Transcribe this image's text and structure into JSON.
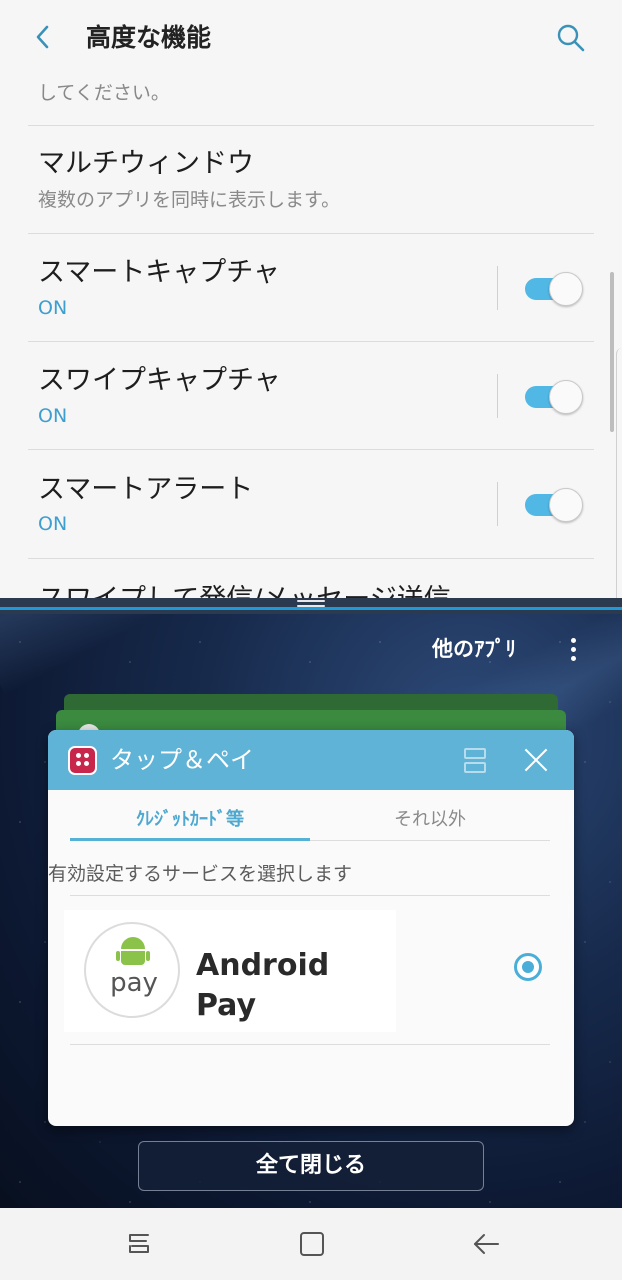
{
  "header": {
    "title": "高度な機能",
    "back_icon": "arrow-left-icon",
    "search_icon": "search-icon"
  },
  "settings": {
    "partial_text": "してください。",
    "multi_window": {
      "title": "マルチウィンドウ",
      "subtitle": "複数のアプリを同時に表示します。"
    },
    "smart_capture": {
      "title": "スマートキャプチャ",
      "status": "ON",
      "enabled": true
    },
    "swipe_capture": {
      "title": "スワイプキャプチャ",
      "status": "ON",
      "enabled": true
    },
    "smart_alert": {
      "title": "スマートアラート",
      "status": "ON",
      "enabled": true
    },
    "cut_item": {
      "title": "スワイプして発信/メッセージ送信"
    }
  },
  "recents": {
    "other_apps": "他のｱﾌﾟﾘ",
    "close_all": "全て閉じる",
    "card": {
      "title": "タップ＆ペイ",
      "tabs": [
        "ｸﾚｼﾞｯﾄｶｰﾄﾞ等",
        "それ以外"
      ],
      "active_tab": 0,
      "instruction": "有効設定するサービスを選択します",
      "service": {
        "logo_text": "pay",
        "name": "Android Pay",
        "selected": true
      }
    }
  },
  "colors": {
    "accent": "#4aaed8",
    "toggle_on": "#51b7e4",
    "card_header": "#5fb3d6",
    "status_on": "#3e9fcf"
  },
  "navbar": {
    "recents_icon": "recents-icon",
    "home_icon": "home-icon",
    "back_icon": "back-arrow-icon"
  }
}
